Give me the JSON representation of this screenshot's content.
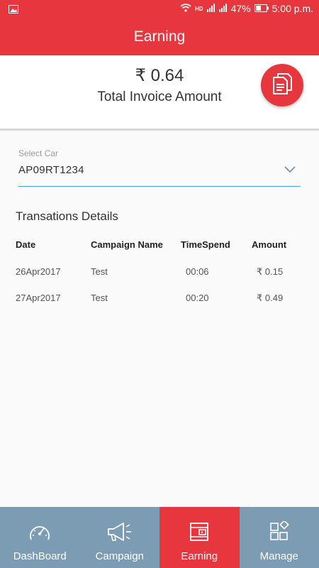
{
  "status_bar": {
    "battery": "47%",
    "time": "5:00 p.m.",
    "icons": [
      "gallery-icon",
      "wifi-icon",
      "hd-icon",
      "signal-icon",
      "signal-icon",
      "battery-icon"
    ]
  },
  "header": {
    "title": "Earning"
  },
  "summary": {
    "amount": "₹ 0.64",
    "caption": "Total Invoice Amount",
    "button_icon": "invoice-icon"
  },
  "select_car": {
    "label": "Select Car",
    "value": "AP09RT1234",
    "icon": "chevron-down-icon"
  },
  "transactions": {
    "title": "Transations Details",
    "columns": [
      "Date",
      "Campaign Name",
      "TimeSpend",
      "Amount"
    ],
    "rows": [
      [
        "26Apr2017",
        "Test",
        "00:06",
        "₹ 0.15"
      ],
      [
        "27Apr2017",
        "Test",
        "00:20",
        "₹ 0.49"
      ]
    ]
  },
  "bottom_nav": {
    "items": [
      {
        "label": "DashBoard",
        "icon": "speedometer-icon"
      },
      {
        "label": "Campaign",
        "icon": "megaphone-icon"
      },
      {
        "label": "Earning",
        "icon": "wallet-icon"
      },
      {
        "label": "Manage",
        "icon": "grid-icon"
      }
    ],
    "active": "Earning"
  },
  "colors": {
    "accent": "#e8363f",
    "nav_background": "#7b9cb2",
    "underline": "#4a9fe0"
  }
}
